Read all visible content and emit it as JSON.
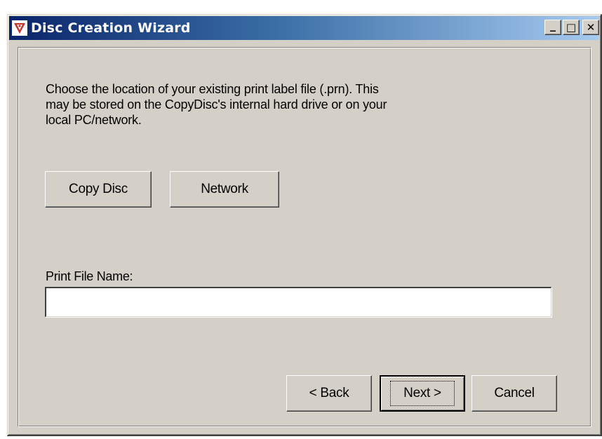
{
  "window": {
    "title": "Disc Creation Wizard",
    "controls": {
      "minimize": "_",
      "maximize": "□",
      "close": "✕"
    }
  },
  "main": {
    "instructions": "Choose the location of your existing print label file (.prn). This\nmay be stored on the CopyDisc's internal hard drive or on your\nlocal PC/network.",
    "location_buttons": {
      "copy_disc": "Copy Disc",
      "network": "Network"
    },
    "print_file": {
      "label": "Print File Name:",
      "value": ""
    }
  },
  "footer": {
    "back": "< Back",
    "next": "Next >",
    "cancel": "Cancel"
  },
  "icons": {
    "app": "disc-wizard-icon"
  },
  "colors": {
    "title_gradient_start": "#0a246a",
    "title_gradient_end": "#a6caf0",
    "dialog_face": "#d4d0c8",
    "app_icon": "#c8322a"
  }
}
